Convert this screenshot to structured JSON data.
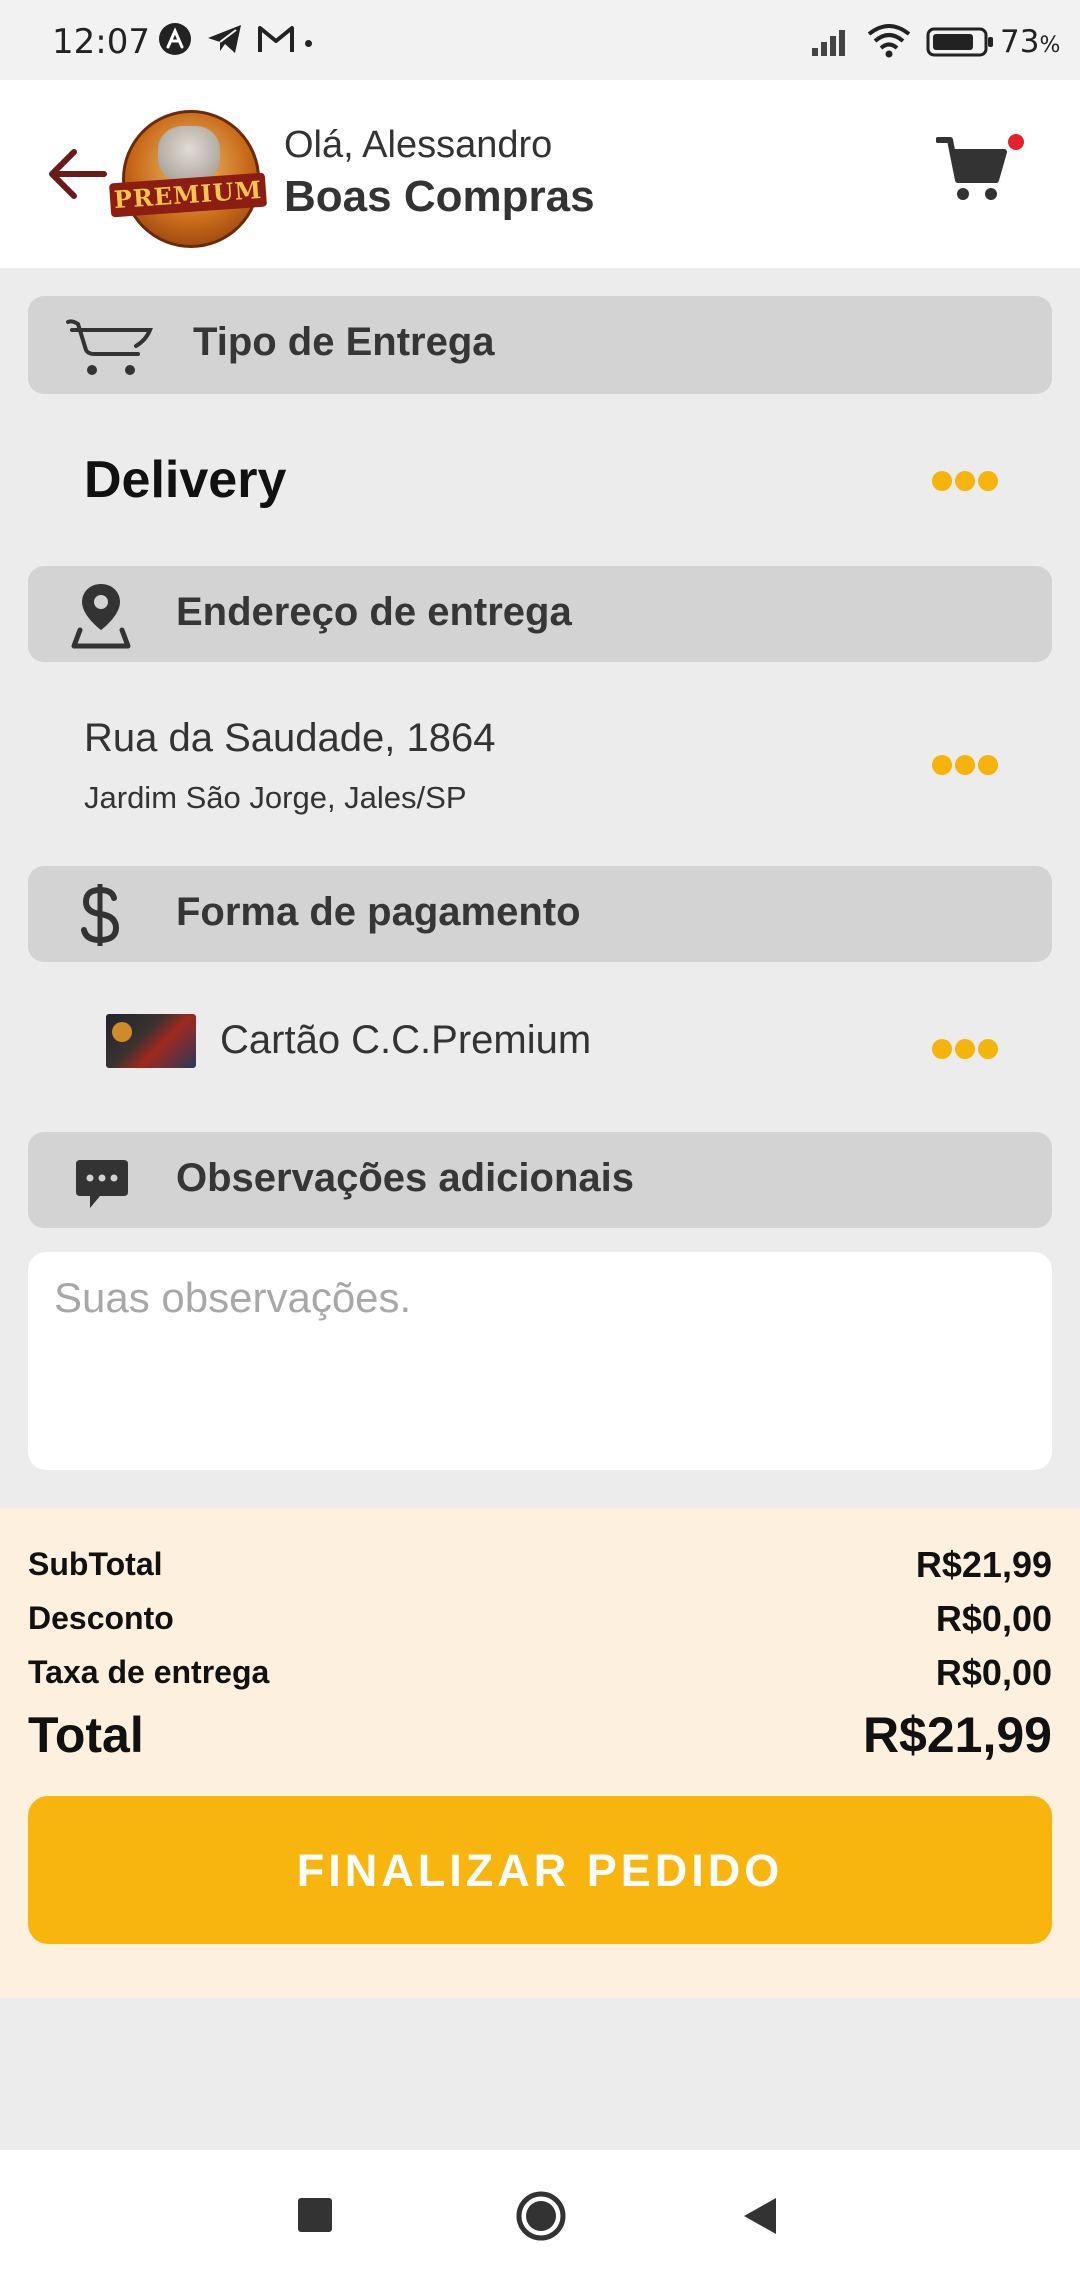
{
  "status_bar": {
    "time": "12:07",
    "battery_percent": "73",
    "battery_unit": "%"
  },
  "header": {
    "greeting": "Olá, Alessandro",
    "subtitle": "Boas Compras",
    "logo_text": "PREMIUM"
  },
  "sections": {
    "delivery_type": {
      "title": "Tipo de Entrega",
      "value": "Delivery"
    },
    "address": {
      "title": "Endereço de entrega",
      "line1": "Rua da Saudade, 1864",
      "line2": "Jardim São Jorge, Jales/SP"
    },
    "payment": {
      "title": "Forma de pagamento",
      "method": "Cartão C.C.Premium"
    },
    "notes": {
      "title": "Observações adicionais",
      "placeholder": "Suas observações.",
      "value": ""
    }
  },
  "totals": {
    "subtotal_label": "SubTotal",
    "subtotal_value": "R$21,99",
    "discount_label": "Desconto",
    "discount_value": "R$0,00",
    "delivery_fee_label": "Taxa de entrega",
    "delivery_fee_value": "R$0,00",
    "total_label": "Total",
    "total_value": "R$21,99"
  },
  "actions": {
    "checkout_label": "FINALIZAR PEDIDO"
  },
  "colors": {
    "accent": "#f7b50e",
    "section_bg": "#d3d3d3",
    "totals_bg": "#fdf0df",
    "notification": "#e8202a",
    "back_arrow": "#6b1a1a"
  },
  "icons": {
    "status_left": [
      "a-logo-icon",
      "telegram-icon",
      "gmail-icon"
    ],
    "status_right": [
      "signal-icon",
      "wifi-icon",
      "battery-icon"
    ],
    "header": [
      "back-arrow-icon",
      "cart-icon"
    ],
    "sections": [
      "cart-outline-icon",
      "map-pin-icon",
      "dollar-icon",
      "chat-bubble-icon"
    ],
    "nav": [
      "square-icon",
      "circle-icon",
      "triangle-back-icon"
    ]
  }
}
